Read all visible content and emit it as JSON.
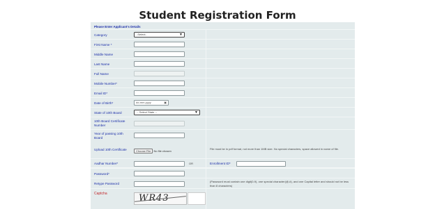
{
  "page": {
    "title": "Student Registration Form"
  },
  "form": {
    "section_heading": "Please Enter Applicant's Details",
    "category": {
      "label": "Category",
      "value": "-Select-"
    },
    "first_name": {
      "label": "First Name *"
    },
    "middle_name": {
      "label": "Middle Name"
    },
    "last_name": {
      "label": "Last Name"
    },
    "full_name": {
      "label": "Full Name"
    },
    "mobile": {
      "label": "Mobile Number*"
    },
    "email": {
      "label": "Email ID*"
    },
    "dob": {
      "label": "Date of Birth*",
      "placeholder": "dd-mm-yyyy"
    },
    "board_state": {
      "label": "State of 10th Board",
      "value": "-- Select State --"
    },
    "board_cert": {
      "label": "10th Board Certificate Number"
    },
    "year_passing": {
      "label": "Year of passing 10th Board"
    },
    "upload": {
      "label": "Upload 10th Certificate",
      "button": "Choose File",
      "status": "No file chosen",
      "note": "File must be in pdf format, not more than 1MB size. No special characters, space allowed in name of file."
    },
    "aadhar": {
      "label": "Aadhar Number*",
      "or_text": "OR"
    },
    "enrollment": {
      "label": "Enrollment ID*"
    },
    "password": {
      "label": "Password*"
    },
    "retype_password": {
      "label": "Retype Password",
      "note": "(Password must contain one digit(0-9), one special character(@,#), and one Capital letter and should not be less than 8 characters)"
    },
    "captcha": {
      "label": "Captcha",
      "text": "WR43"
    }
  }
}
